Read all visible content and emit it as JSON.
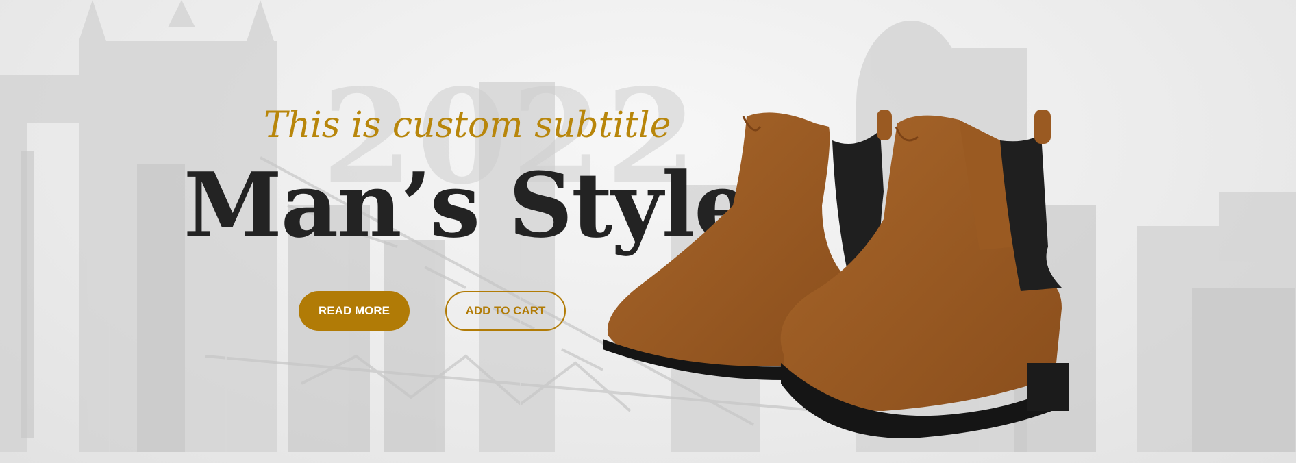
{
  "hero": {
    "watermark": "2022",
    "subtitle": "This is custom subtitle",
    "title": "Man’s Style",
    "buttons": {
      "read_more": "READ MORE",
      "add_to_cart": "ADD TO CART"
    },
    "colors": {
      "accent": "#b17b06",
      "title": "#232323",
      "boot_suede": "#9a5a22",
      "boot_elastic": "#1e1e1e",
      "sole": "#151515"
    },
    "icons": [
      "city-skyline-background",
      "chelsea-boots-image"
    ]
  }
}
